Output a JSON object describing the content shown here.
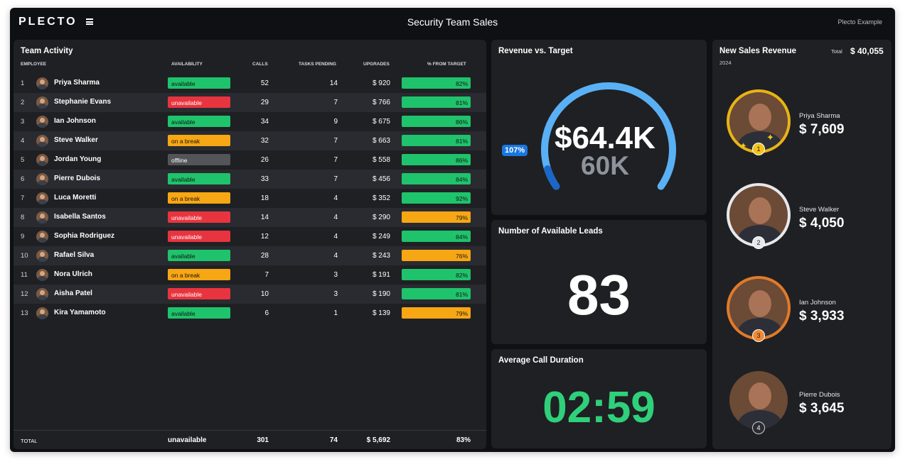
{
  "topbar": {
    "logo": "PLECTO",
    "title": "Security Team Sales",
    "account": "Plecto Example"
  },
  "team": {
    "title": "Team Activity",
    "headers": {
      "employee": "EMPLOYEE",
      "availability": "AVAILABILITY",
      "calls": "CALLS",
      "tasks": "TASKS PENDING",
      "upgrades": "UPGRADES",
      "target": "% FROM TARGET"
    },
    "rows": [
      {
        "rank": "1",
        "name": "Priya Sharma",
        "availability": "available",
        "calls": "52",
        "tasks": "14",
        "upgrades": "$ 920",
        "target": "82%",
        "target_color": "#1fc36b"
      },
      {
        "rank": "2",
        "name": "Stephanie Evans",
        "availability": "unavailable",
        "calls": "29",
        "tasks": "7",
        "upgrades": "$ 766",
        "target": "81%",
        "target_color": "#1fc36b"
      },
      {
        "rank": "3",
        "name": "Ian Johnson",
        "availability": "available",
        "calls": "34",
        "tasks": "9",
        "upgrades": "$ 675",
        "target": "86%",
        "target_color": "#1fc36b"
      },
      {
        "rank": "4",
        "name": "Steve Walker",
        "availability": "on a break",
        "calls": "32",
        "tasks": "7",
        "upgrades": "$ 663",
        "target": "81%",
        "target_color": "#1fc36b"
      },
      {
        "rank": "5",
        "name": "Jordan Young",
        "availability": "offline",
        "calls": "26",
        "tasks": "7",
        "upgrades": "$ 558",
        "target": "86%",
        "target_color": "#1fc36b"
      },
      {
        "rank": "6",
        "name": "Pierre Dubois",
        "availability": "available",
        "calls": "33",
        "tasks": "7",
        "upgrades": "$ 456",
        "target": "84%",
        "target_color": "#1fc36b"
      },
      {
        "rank": "7",
        "name": "Luca Moretti",
        "availability": "on a break",
        "calls": "18",
        "tasks": "4",
        "upgrades": "$ 352",
        "target": "92%",
        "target_color": "#1fc36b"
      },
      {
        "rank": "8",
        "name": "Isabella Santos",
        "availability": "unavailable",
        "calls": "14",
        "tasks": "4",
        "upgrades": "$ 290",
        "target": "79%",
        "target_color": "#f7a614"
      },
      {
        "rank": "9",
        "name": "Sophia Rodriguez",
        "availability": "unavailable",
        "calls": "12",
        "tasks": "4",
        "upgrades": "$ 249",
        "target": "84%",
        "target_color": "#1fc36b"
      },
      {
        "rank": "10",
        "name": "Rafael Silva",
        "availability": "available",
        "calls": "28",
        "tasks": "4",
        "upgrades": "$ 243",
        "target": "76%",
        "target_color": "#f7a614"
      },
      {
        "rank": "11",
        "name": "Nora Ulrich",
        "availability": "on a break",
        "calls": "7",
        "tasks": "3",
        "upgrades": "$ 191",
        "target": "82%",
        "target_color": "#1fc36b"
      },
      {
        "rank": "12",
        "name": "Aisha Patel",
        "availability": "unavailable",
        "calls": "10",
        "tasks": "3",
        "upgrades": "$ 190",
        "target": "81%",
        "target_color": "#1fc36b"
      },
      {
        "rank": "13",
        "name": "Kira Yamamoto",
        "availability": "available",
        "calls": "6",
        "tasks": "1",
        "upgrades": "$ 139",
        "target": "79%",
        "target_color": "#f7a614"
      }
    ],
    "availability_colors": {
      "available": "#1fc36b",
      "unavailable": "#e8343f",
      "on a break": "#f7a614",
      "offline": "#545558"
    },
    "total": {
      "label": "TOTAL",
      "availability": "unavailable",
      "calls": "301",
      "tasks": "74",
      "upgrades": "$ 5,692",
      "target": "83%"
    }
  },
  "revenue": {
    "title": "Revenue vs. Target",
    "value": "$64.4K",
    "target": "60K",
    "percent_label": "107%",
    "progress_fraction": 1.07,
    "arc_color": "#5ab0f5",
    "arc_dark_color": "#1a67c8"
  },
  "leads": {
    "title": "Number of Available Leads",
    "value": "83"
  },
  "calls": {
    "title": "Average Call Duration",
    "value": "02:59",
    "color": "#2fd07a"
  },
  "sales": {
    "title": "New Sales Revenue",
    "year": "2024",
    "total_label": "Total",
    "total": "$ 40,055",
    "leaders": [
      {
        "rank": "1",
        "name": "Priya Sharma",
        "amount": "$ 7,609",
        "ring_color": "#e8b415",
        "badge_color": "#f2c41c"
      },
      {
        "rank": "2",
        "name": "Steve Walker",
        "amount": "$ 4,050",
        "ring_color": "#e6e8ec",
        "badge_color": "#e6e8ec"
      },
      {
        "rank": "3",
        "name": "Ian Johnson",
        "amount": "$ 3,933",
        "ring_color": "#e07a2a",
        "badge_color": "#f08a32"
      },
      {
        "rank": "4",
        "name": "Pierre Dubois",
        "amount": "$ 3,645",
        "ring_color": "#1f2023",
        "badge_color": "#2a2c31"
      }
    ]
  }
}
